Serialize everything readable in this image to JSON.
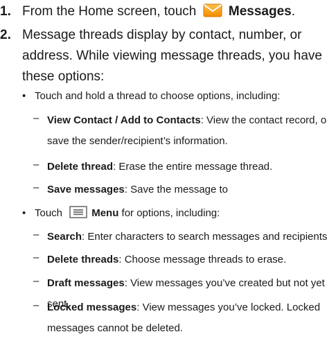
{
  "steps": [
    {
      "number": "1.",
      "text_before": "From the Home screen, touch",
      "icon": "messages-envelope-icon",
      "bold": "Messages",
      "text_after": "."
    },
    {
      "number": "2.",
      "lines": [
        "Message threads display by contact, number, or",
        "address. While viewing message threads, you have",
        "these options:"
      ]
    }
  ],
  "bullets": [
    {
      "text": "Touch and hold a thread to choose options, including:",
      "items": [
        {
          "term": "View Contact / Add to Contacts",
          "desc_line1": ": View the contact record, or",
          "desc_line2": "save the sender/recipient’s information."
        },
        {
          "term": "Delete thread",
          "desc_line1": ": Erase the entire message thread.",
          "desc_line2": ""
        },
        {
          "term": "Save messages",
          "desc_line1": ": Save the message to",
          "desc_line2": ""
        }
      ]
    },
    {
      "text_before": "Touch",
      "icon": "menu-key-icon",
      "bold": "Menu",
      "text_after": " for options, including:",
      "items": [
        {
          "term": "Search",
          "desc_line1": ": Enter characters to search messages and recipients.",
          "desc_line2": ""
        },
        {
          "term": "Delete threads",
          "desc_line1": ": Choose message threads to erase.",
          "desc_line2": ""
        },
        {
          "term": "Draft messages",
          "desc_line1": ": View messages you’ve created but not yet",
          "desc_line2": "sent."
        },
        {
          "term": "Locked messages",
          "desc_line1": ": View messages you’ve locked. Locked",
          "desc_line2": "messages cannot be deleted."
        }
      ]
    }
  ],
  "bullet_symbol": "•",
  "dash_symbol": "–",
  "colors": {
    "icon_orange": "#f7a21a",
    "icon_orange_dark": "#e07d00",
    "menu_icon": "#6d6d6d"
  }
}
